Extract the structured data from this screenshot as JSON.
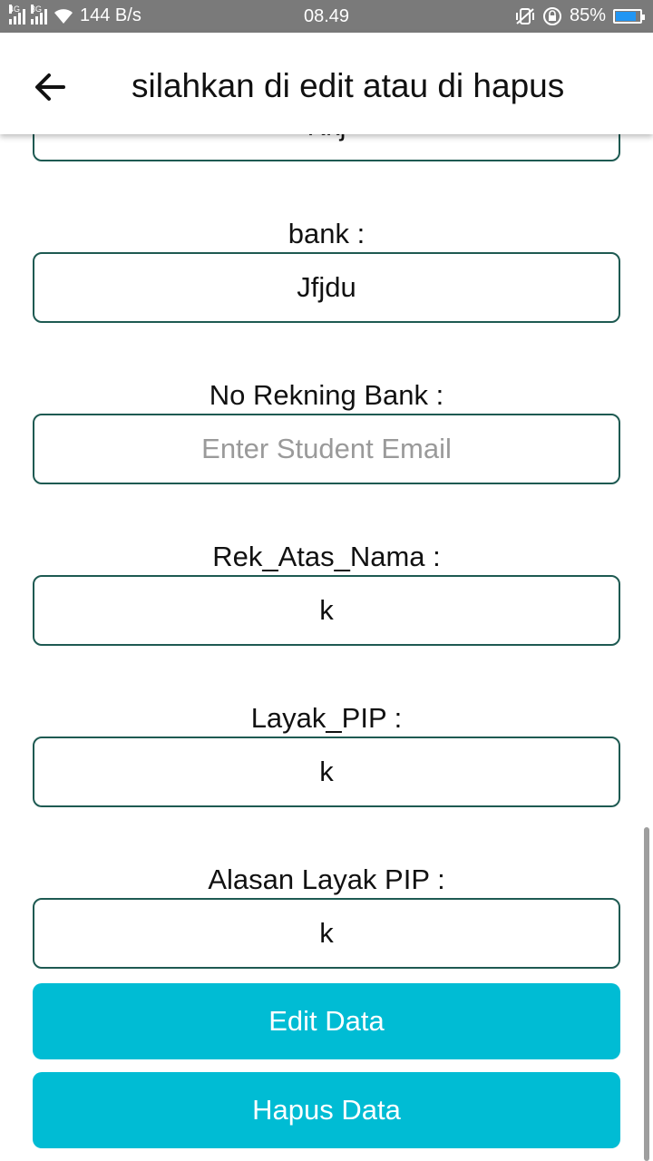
{
  "status_bar": {
    "net1": "4G",
    "net2": "3G",
    "speed": "144 B/s",
    "time": "08.49",
    "battery": "85%",
    "battery_level": 0.85,
    "icons": [
      "signal-icon",
      "wifi-icon",
      "vibrate-icon",
      "rotation-lock-icon",
      "battery-icon"
    ]
  },
  "toolbar": {
    "back_icon": "arrow-back-icon",
    "title": "silahkan di edit atau di hapus"
  },
  "form": {
    "partial_top_value": "Kkj",
    "fields": [
      {
        "label": "bank :",
        "value": "Jfjdu"
      },
      {
        "label": "No Rekning Bank :",
        "value": "",
        "placeholder": "Enter Student Email"
      },
      {
        "label": "Rek_Atas_Nama :",
        "value": "k"
      },
      {
        "label": "Layak_PIP :",
        "value": "k"
      },
      {
        "label": "Alasan Layak PIP :",
        "value": "k"
      }
    ]
  },
  "buttons": {
    "edit": "Edit Data",
    "delete": "Hapus Data"
  },
  "colors": {
    "accent": "#00bcd4",
    "field_border": "#1e5a52",
    "status_bar": "#7a7a7a"
  }
}
